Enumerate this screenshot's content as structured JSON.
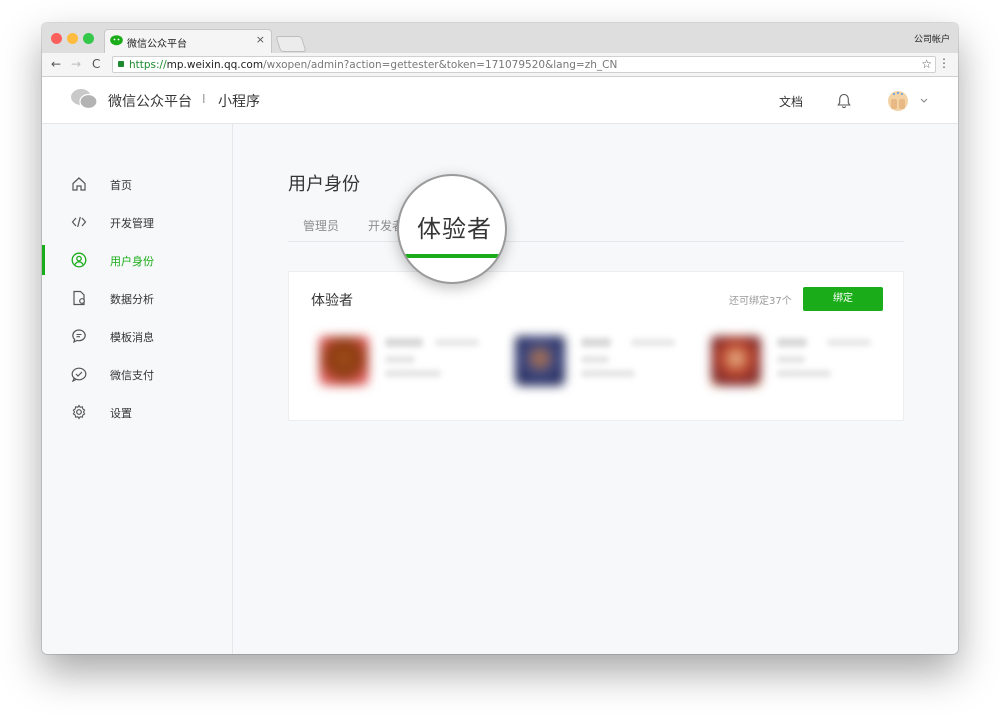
{
  "browser": {
    "tab_title": "微信公众平台",
    "tab_close": "×",
    "account_label": "公司帐户",
    "url_scheme": "https://",
    "url_host": "mp.weixin.qq.com",
    "url_path": "/wxopen/admin?action=gettester&token=171079520&lang=zh_CN",
    "nav": {
      "back": "←",
      "forward": "→",
      "reload": "C"
    },
    "star": "☆",
    "menu": "⋮"
  },
  "header": {
    "title": "微信公众平台",
    "divider": "I",
    "subtitle": "小程序",
    "docs_label": "文档"
  },
  "sidebar": {
    "items": [
      {
        "label": "首页",
        "icon": "home-icon",
        "active": false
      },
      {
        "label": "开发管理",
        "icon": "code-icon",
        "active": false
      },
      {
        "label": "用户身份",
        "icon": "user-circle-icon",
        "active": true
      },
      {
        "label": "数据分析",
        "icon": "document-chart-icon",
        "active": false
      },
      {
        "label": "模板消息",
        "icon": "message-icon",
        "active": false
      },
      {
        "label": "微信支付",
        "icon": "payment-icon",
        "active": false
      },
      {
        "label": "设置",
        "icon": "gear-icon",
        "active": false
      }
    ]
  },
  "main": {
    "page_title": "用户身份",
    "tabs": [
      {
        "label": "管理员"
      },
      {
        "label": "开发者"
      },
      {
        "label": "体验者",
        "active": true
      }
    ],
    "card": {
      "title": "体验者",
      "hint": "还可绑定37个",
      "bind_label": "绑定"
    }
  },
  "colors": {
    "accent": "#1aad19",
    "text": "#353535",
    "muted": "#8d8d8d"
  }
}
